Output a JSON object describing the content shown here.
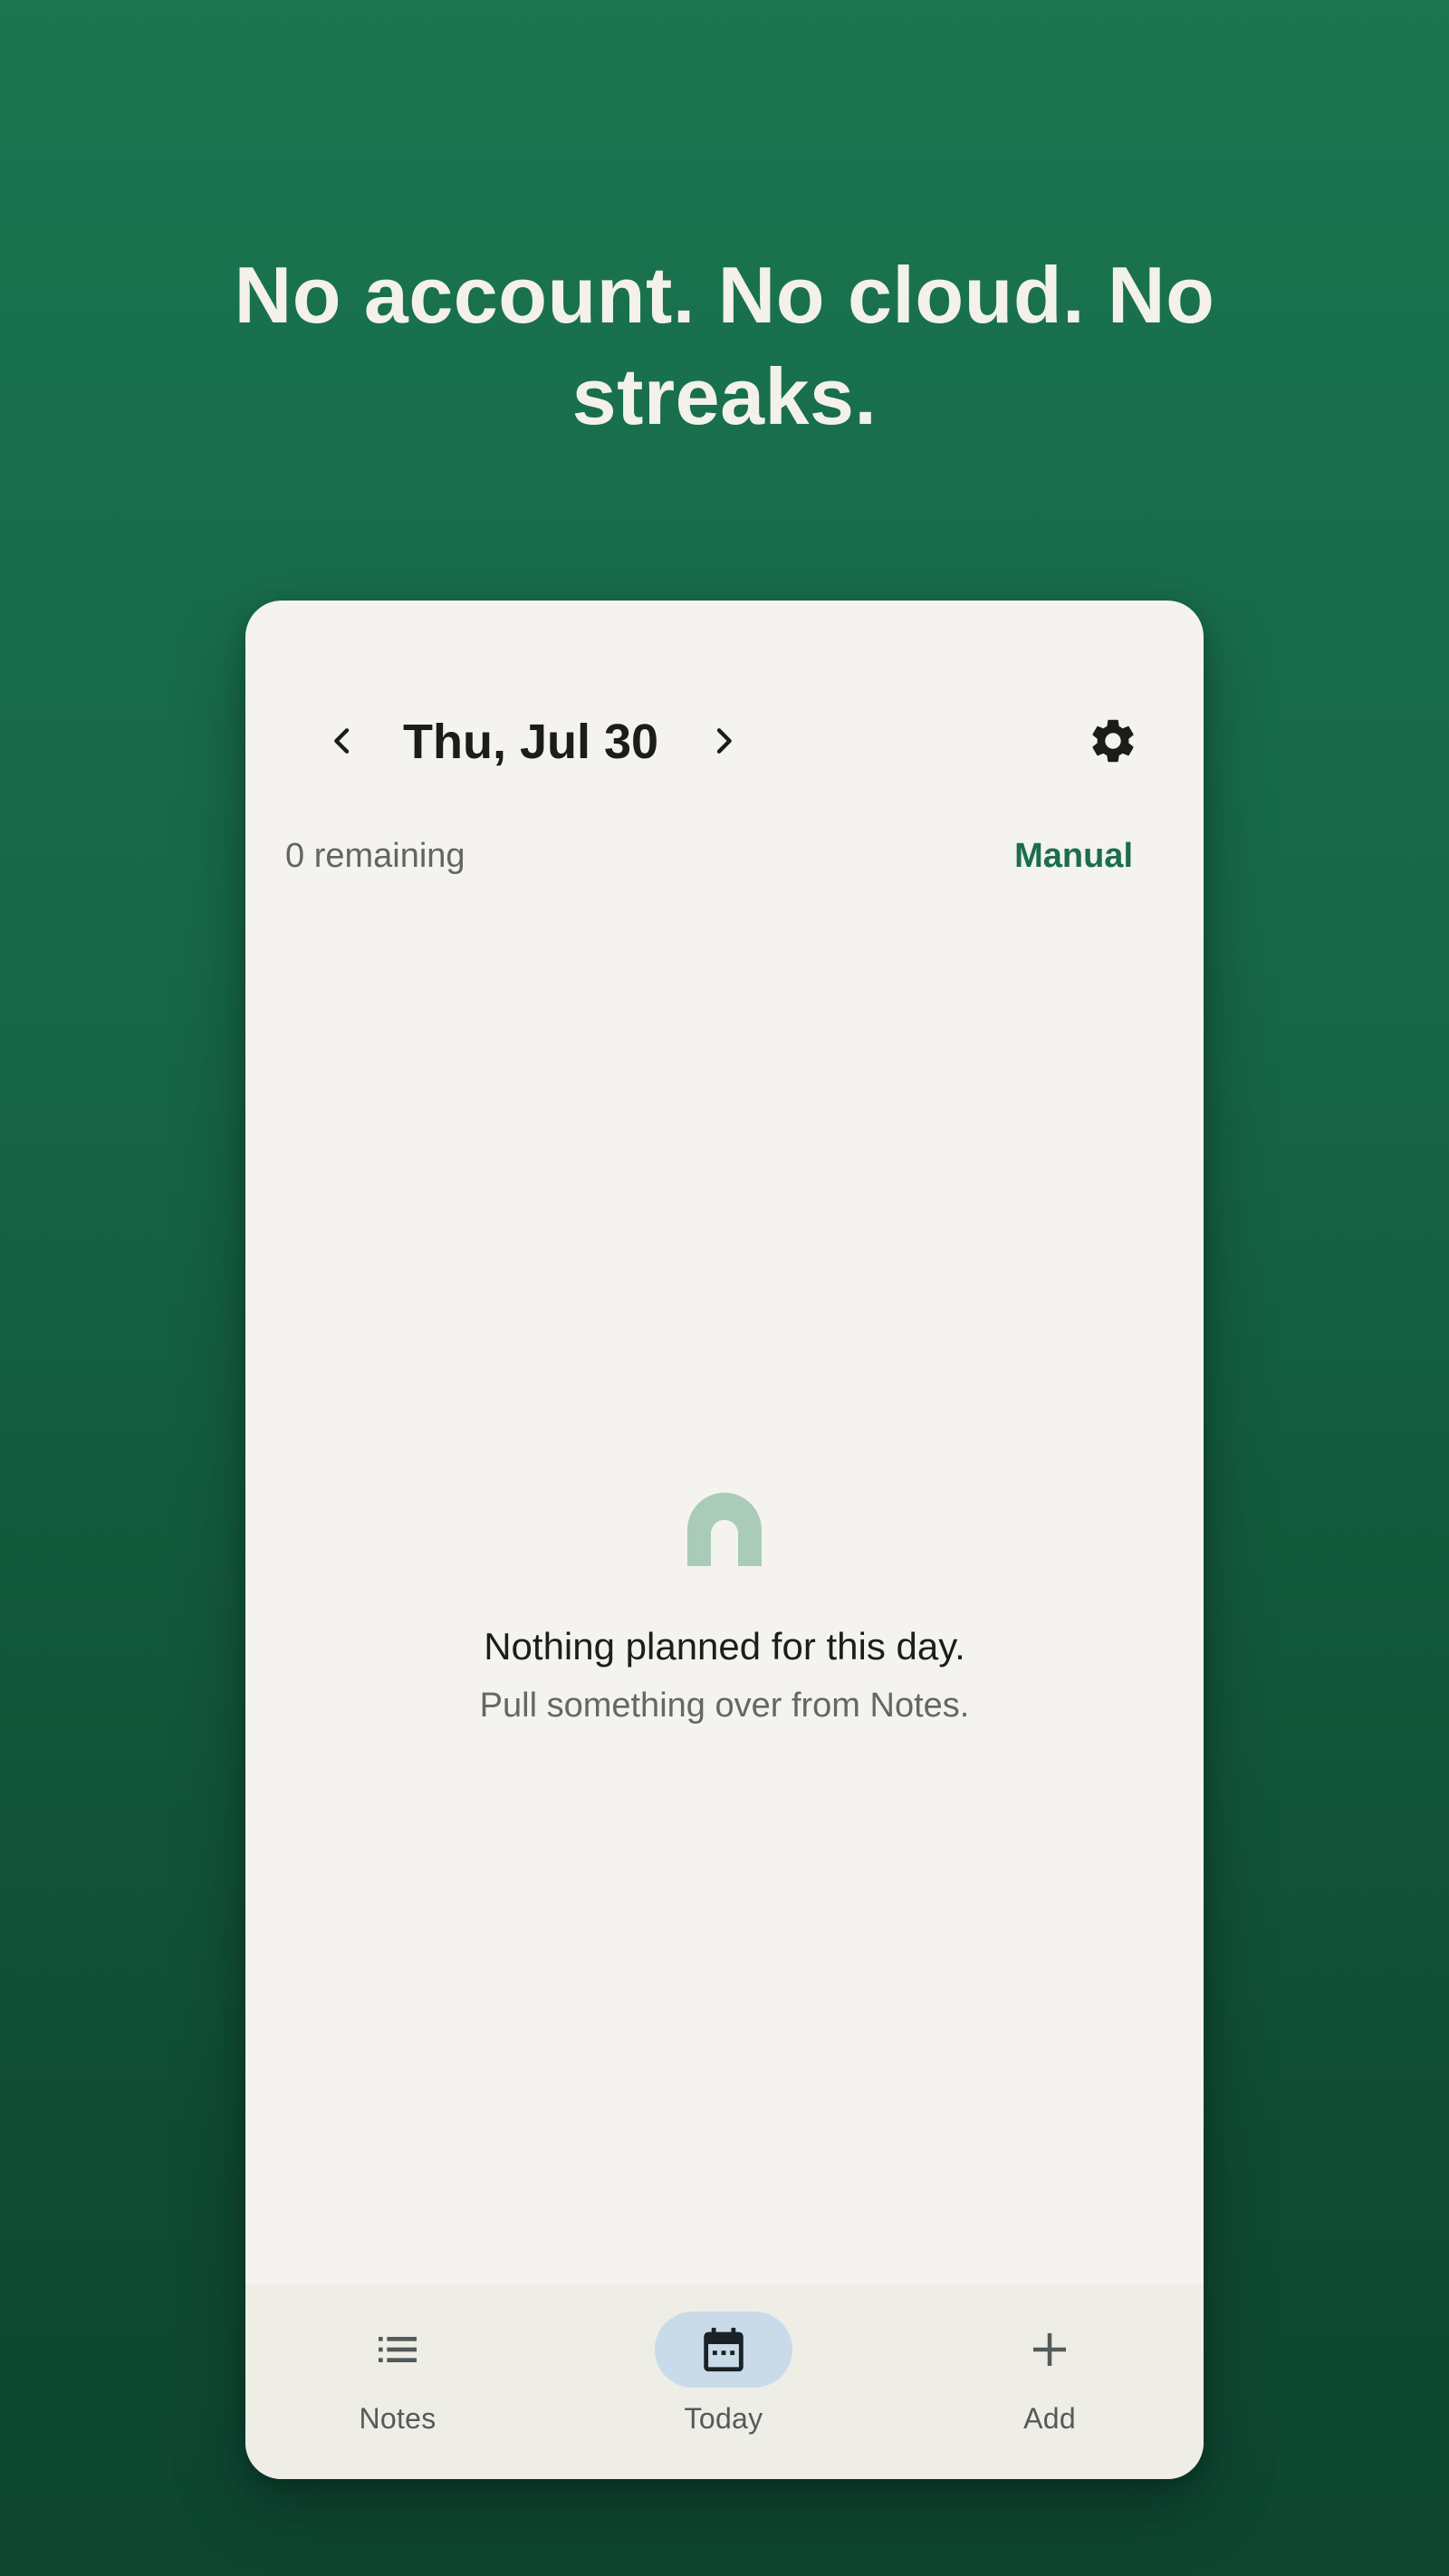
{
  "hero": {
    "headline": "No account. No cloud. No streaks."
  },
  "header": {
    "date": "Thu, Jul 30",
    "prev_icon": "chevron-left-icon",
    "next_icon": "chevron-right-icon",
    "settings_icon": "gear-icon"
  },
  "status": {
    "remaining": "0 remaining",
    "sort_mode": "Manual"
  },
  "empty_state": {
    "icon": "arch-icon",
    "title": "Nothing planned for this day.",
    "subtitle": "Pull something over from Notes."
  },
  "bottom_nav": {
    "items": [
      {
        "label": "Notes",
        "icon": "list-icon"
      },
      {
        "label": "Today",
        "icon": "calendar-icon",
        "selected": true
      },
      {
        "label": "Add",
        "icon": "plus-icon"
      }
    ]
  },
  "colors": {
    "background_top": "#1a7550",
    "background_bottom": "#0e4631",
    "accent": "#1b6e4b",
    "card": "#f5f3ef",
    "selected_tab": "#c9dbe8",
    "empty_icon": "#a9cbb8"
  }
}
